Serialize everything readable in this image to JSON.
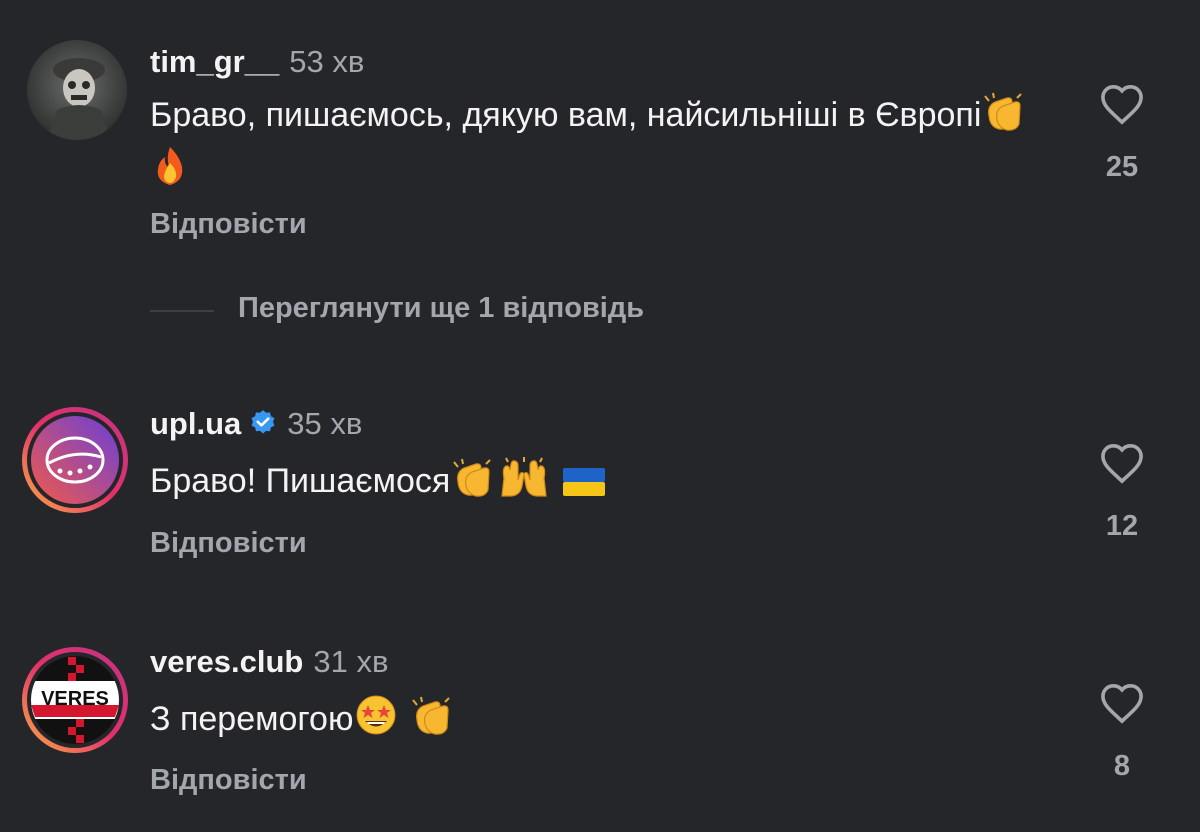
{
  "comments": [
    {
      "username": "tim_gr__",
      "time": "53 хв",
      "text": "Браво, пишаємось, дякую вам, найсильніші в Європі",
      "emojis": [
        "clapping-hands",
        "fire"
      ],
      "reply_label": "Відповісти",
      "likes": "25",
      "verified": false
    },
    {
      "username": "upl.ua",
      "time": "35 хв",
      "text": "Браво! Пишаємося",
      "emojis": [
        "clapping-hands",
        "raising-hands",
        "ukraine-flag"
      ],
      "reply_label": "Відповісти",
      "likes": "12",
      "verified": true
    },
    {
      "username": "veres.club",
      "time": "31 хв",
      "text": "З перемогою",
      "emojis": [
        "star-struck",
        "clapping-hands"
      ],
      "reply_label": "Відповісти",
      "likes": "8",
      "verified": false,
      "avatar_text": "VERES"
    }
  ],
  "view_more": "Переглянути ще 1 відповідь",
  "colors": {
    "background": "#25262a",
    "text_primary": "#f3f3f3",
    "text_secondary": "#a3a6ad",
    "verified_blue": "#3897f0",
    "story_ring_start": "#fcaf45",
    "story_ring_end": "#c13584"
  }
}
